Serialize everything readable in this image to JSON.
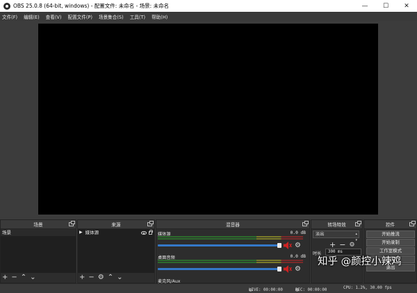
{
  "window": {
    "title": "OBS 25.0.8 (64-bit, windows) - 配置文件: 未命名 - 场景: 未命名",
    "minimize": "—",
    "maximize": "☐",
    "close": "✕"
  },
  "menu": [
    "文件(F)",
    "编辑(E)",
    "查看(V)",
    "配置文件(P)",
    "场景集合(S)",
    "工具(T)",
    "帮助(H)"
  ],
  "docks": {
    "scenes": {
      "title": "场景",
      "items": [
        "场景"
      ]
    },
    "sources": {
      "title": "来源",
      "items": [
        "媒体源"
      ]
    },
    "mixer": {
      "title": "混音器",
      "channels": [
        {
          "name": "媒体源",
          "db": "0.0 dB"
        },
        {
          "name": "桌面音频",
          "db": "0.0 dB"
        },
        {
          "name": "麦克风/Aux",
          "db": ""
        }
      ]
    },
    "transitions": {
      "title": "转场特效",
      "selected": "淡出",
      "duration_label": "时长",
      "duration_value": "300 ms"
    },
    "controls": {
      "title": "控件",
      "buttons": [
        "开始推流",
        "开始录制",
        "工作室模式",
        "设置",
        "退出"
      ]
    }
  },
  "statusbar": {
    "live": "LIVE: 00:00:00",
    "rec": "REC: 00:00:00",
    "cpu": "CPU: 1.2%, 30.00 fps"
  },
  "watermark": "知乎 @颜控小辣鸡",
  "colors": {
    "window_bg": "#3a3a3a",
    "preview_bg": "#000000",
    "volume_slider": "#3478c8",
    "muted_speaker": "#cc2222"
  }
}
